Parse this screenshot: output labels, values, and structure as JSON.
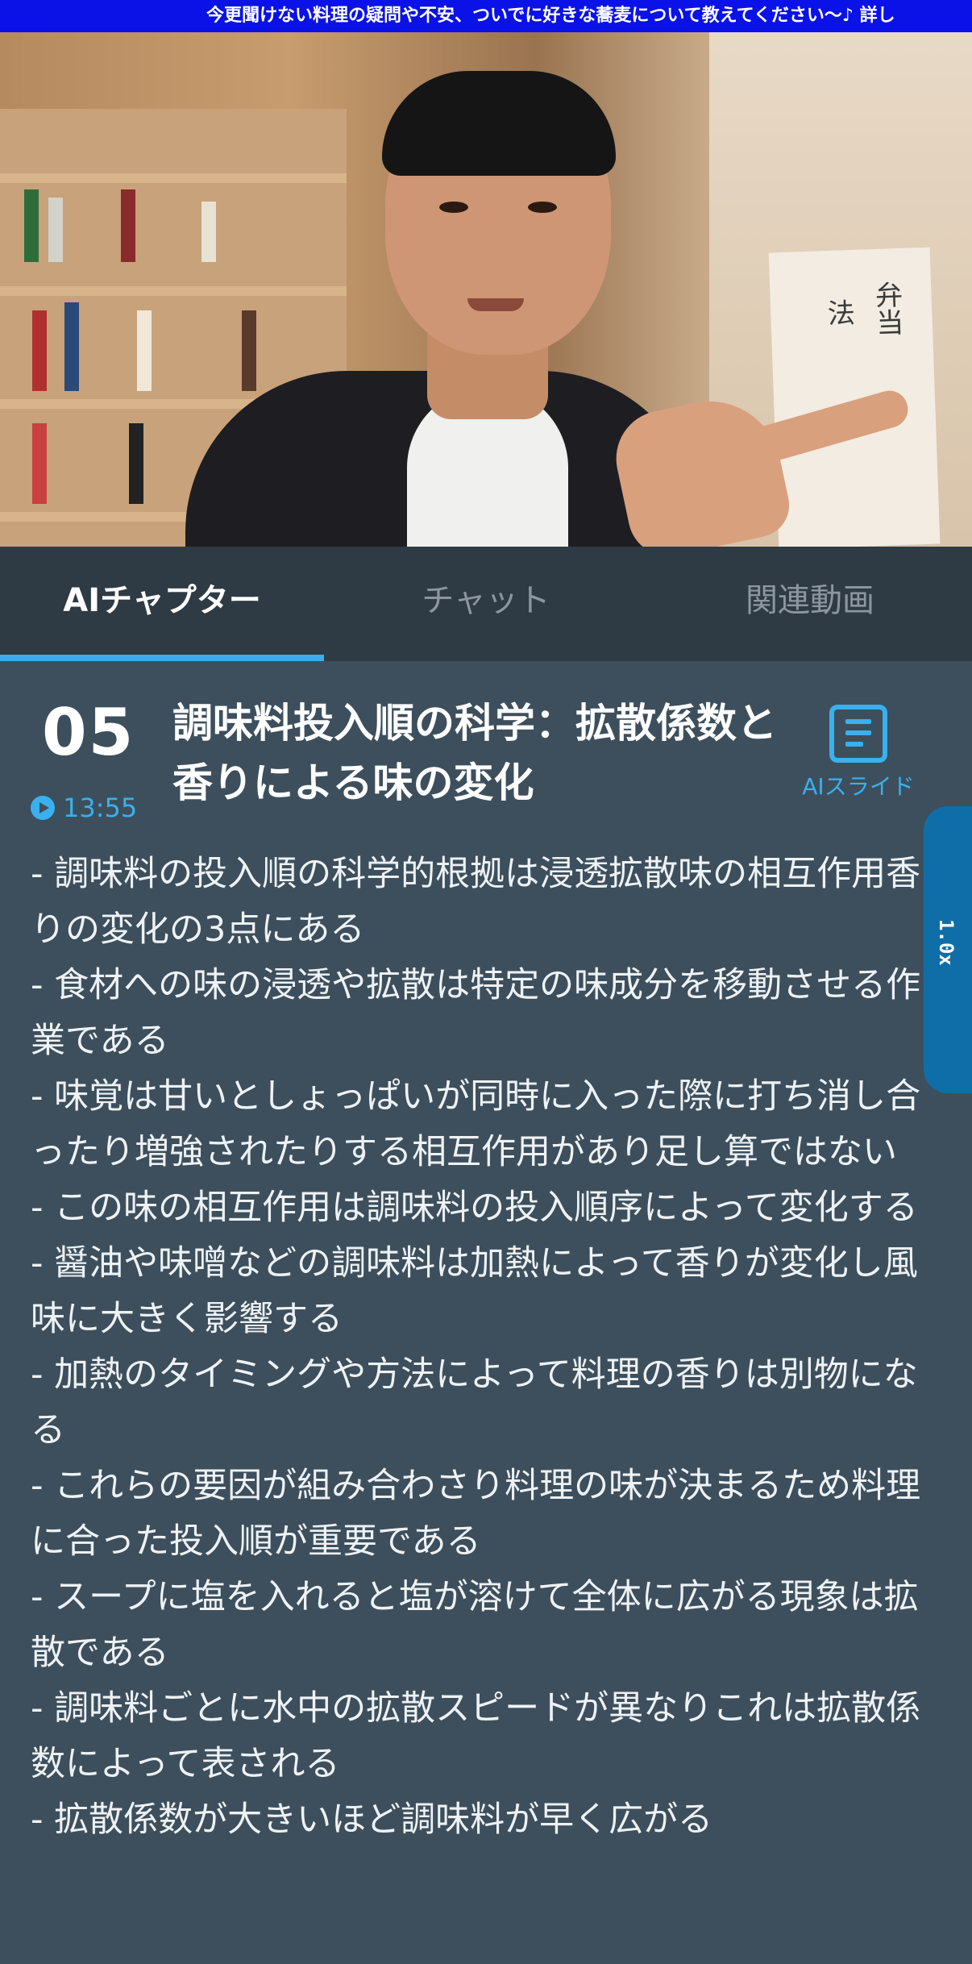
{
  "banner": {
    "text": "今更聞けない料理の疑問や不安、ついでに好きな蕎麦について教えてください〜♪ 詳し"
  },
  "video": {
    "paper_text_1": "弁当",
    "paper_text_2": "法"
  },
  "tabs": [
    {
      "label": "AIチャプター"
    },
    {
      "label": "チャット"
    },
    {
      "label": "関連動画"
    }
  ],
  "chapter": {
    "number": "05",
    "timestamp": "13:55",
    "title": "調味料投入順の科学：拡散係数と香りによる味の変化",
    "slide_label": "AIスライド"
  },
  "side_handle": {
    "label": "1.0x"
  },
  "summary": [
    "- 調味料の投入順の科学的根拠は浸透拡散味の相互作用香りの変化の3点にある",
    "- 食材への味の浸透や拡散は特定の味成分を移動させる作業である",
    "- 味覚は甘いとしょっぱいが同時に入った際に打ち消し合ったり増強されたりする相互作用があり足し算ではない",
    "- この味の相互作用は調味料の投入順序によって変化する",
    "- 醤油や味噌などの調味料は加熱によって香りが変化し風味に大きく影響する",
    "- 加熱のタイミングや方法によって料理の香りは別物になる",
    "- これらの要因が組み合わさり料理の味が決まるため料理に合った投入順が重要である",
    "- スープに塩を入れると塩が溶けて全体に広がる現象は拡散である",
    "- 調味料ごとに水中の拡散スピードが異なりこれは拡散係数によって表される",
    "- 拡散係数が大きいほど調味料が早く広がる"
  ],
  "colors": {
    "accent": "#3ab0ee",
    "background": "#3d4f5c",
    "tab_bar": "#2e3a44",
    "banner": "#0a12e8"
  }
}
